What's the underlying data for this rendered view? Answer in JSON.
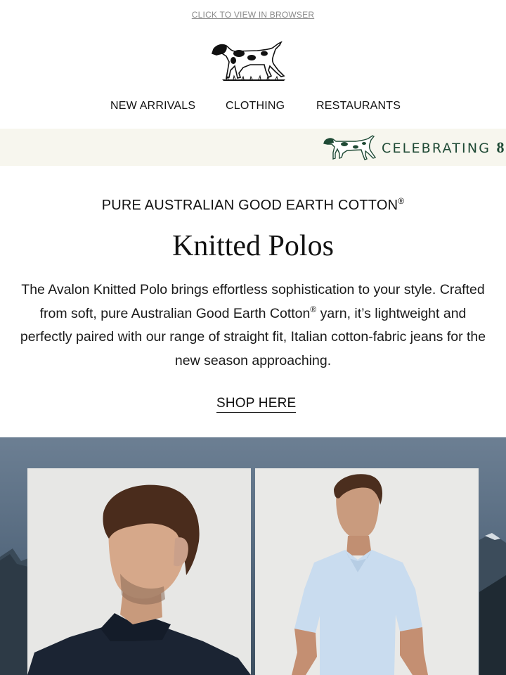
{
  "header": {
    "view_in_browser": "CLICK TO VIEW IN BROWSER",
    "logo_icon": "pointer-dog-logo"
  },
  "nav": {
    "items": [
      {
        "label": "NEW ARRIVALS"
      },
      {
        "label": "CLOTHING"
      },
      {
        "label": "RESTAURANTS"
      }
    ]
  },
  "banner": {
    "text": "CELEBRATING ",
    "number_fragment": "8",
    "icon": "pointer-dog-icon",
    "text_color": "#1f4a35",
    "background": "#f7f6ee"
  },
  "feature": {
    "eyebrow": "PURE AUSTRALIAN GOOD EARTH COTTON",
    "eyebrow_mark": "®",
    "title": "Knitted Polos",
    "body_part1": "The Avalon Knitted Polo brings effortless sophistication to your style. Crafted from soft, pure Australian Good Earth Cotton",
    "body_mark": "®",
    "body_part2": " yarn, it’s lightweight and perfectly paired with our range of straight fit, Italian cotton-fabric jeans for the new season approaching.",
    "cta": "SHOP HERE"
  },
  "products": [
    {
      "name": "navy-knitted-polo-image",
      "color": "#1b2433"
    },
    {
      "name": "light-blue-knitted-polo-image",
      "color": "#c9dcef"
    }
  ]
}
